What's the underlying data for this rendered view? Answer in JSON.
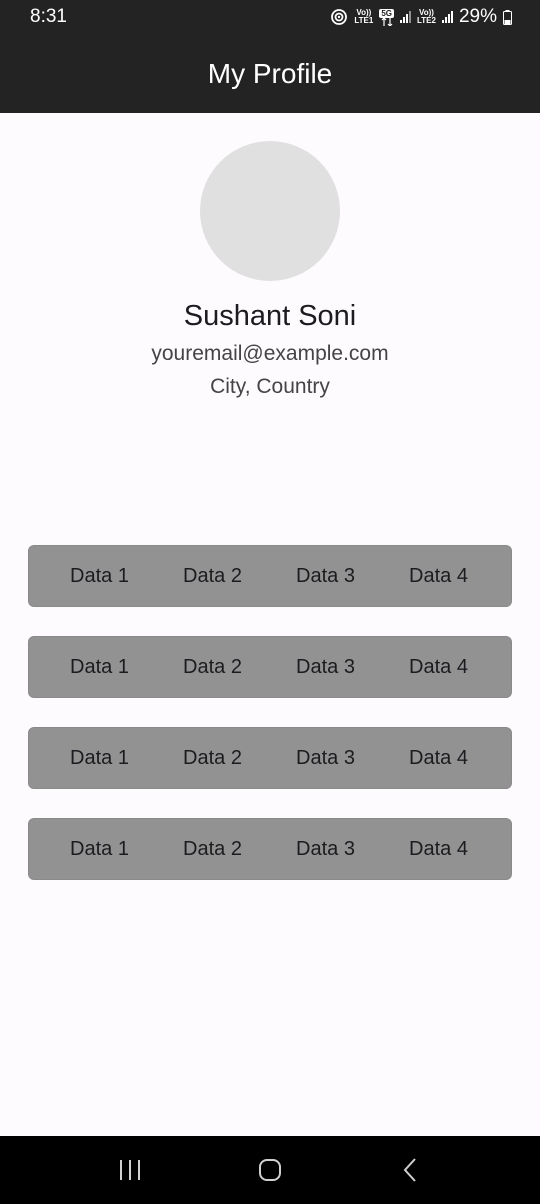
{
  "status_bar": {
    "time": "8:31",
    "volte1": "Vo))",
    "lte1": "LTE1",
    "network": "5G",
    "volte2": "Vo))",
    "lte2": "LTE2",
    "battery": "29%"
  },
  "app_bar": {
    "title": "My Profile"
  },
  "profile": {
    "name": "Sushant Soni",
    "email": "youremail@example.com",
    "location": "City, Country"
  },
  "rows": [
    {
      "cells": [
        "Data 1",
        "Data 2",
        "Data 3",
        "Data 4"
      ]
    },
    {
      "cells": [
        "Data 1",
        "Data 2",
        "Data 3",
        "Data 4"
      ]
    },
    {
      "cells": [
        "Data 1",
        "Data 2",
        "Data 3",
        "Data 4"
      ]
    },
    {
      "cells": [
        "Data 1",
        "Data 2",
        "Data 3",
        "Data 4"
      ]
    }
  ],
  "nav": {
    "recents_icon": "recents-icon",
    "home_icon": "home-icon",
    "back_icon": "back-icon"
  },
  "colors": {
    "app_bar": "#232323",
    "row_background": "#929292",
    "avatar": "#e0e0e0"
  }
}
